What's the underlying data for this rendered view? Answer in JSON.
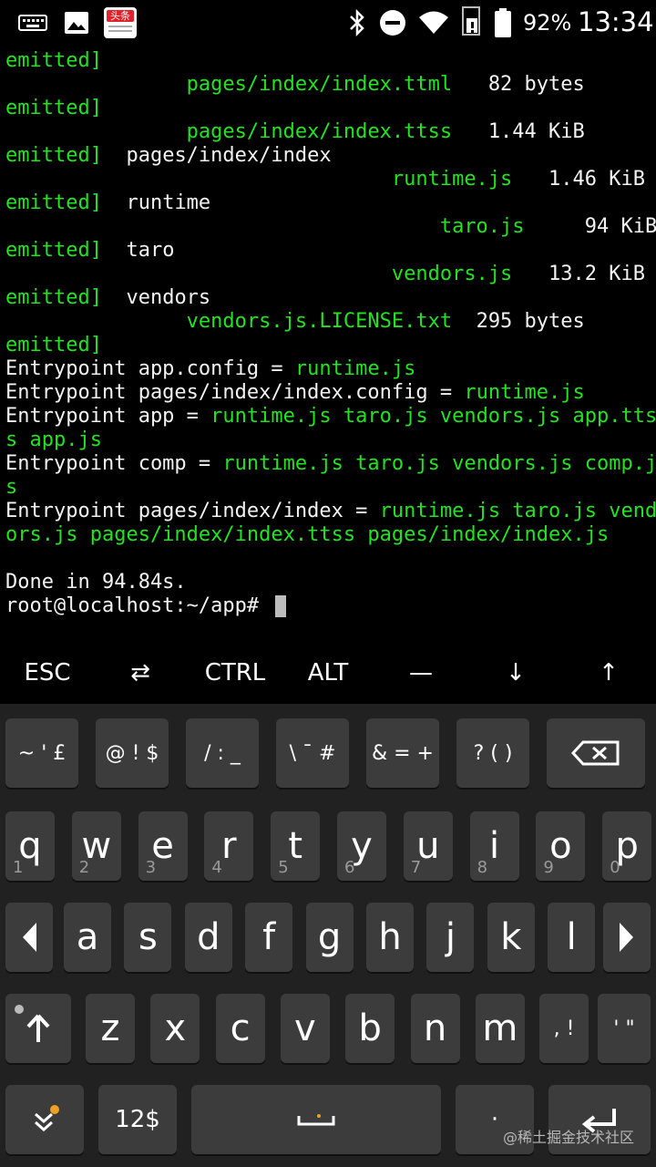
{
  "status_bar": {
    "battery_percent": "92%",
    "time": "13:34",
    "news_app_label": "头条"
  },
  "terminal": {
    "lines": [
      [
        {
          "t": "emitted]",
          "c": "g"
        }
      ],
      [
        {
          "t": "               pages/index/index.ttml",
          "c": "g"
        },
        {
          "t": "   82 bytes        ",
          "c": "w"
        },
        {
          "t": "[",
          "c": "g"
        }
      ],
      [
        {
          "t": "emitted]",
          "c": "g"
        }
      ],
      [
        {
          "t": "               pages/index/index.ttss",
          "c": "g"
        },
        {
          "t": "   1.44 KiB       6  ",
          "c": "w"
        },
        {
          "t": "[",
          "c": "g"
        }
      ],
      [
        {
          "t": "emitted]",
          "c": "g"
        },
        {
          "t": "  pages/index/index",
          "c": "w"
        }
      ],
      [
        {
          "t": "                                runtime.js",
          "c": "g"
        },
        {
          "t": "   1.46 KiB       0  ",
          "c": "w"
        },
        {
          "t": "[",
          "c": "g"
        }
      ],
      [
        {
          "t": "emitted]",
          "c": "g"
        },
        {
          "t": "  runtime",
          "c": "w"
        }
      ],
      [
        {
          "t": "                                    taro.js",
          "c": "g"
        },
        {
          "t": "     94 KiB       1  ",
          "c": "w"
        },
        {
          "t": "[",
          "c": "g"
        }
      ],
      [
        {
          "t": "emitted]",
          "c": "g"
        },
        {
          "t": "  taro",
          "c": "w"
        }
      ],
      [
        {
          "t": "                                vendors.js",
          "c": "g"
        },
        {
          "t": "   13.2 KiB       2  ",
          "c": "w"
        },
        {
          "t": "[",
          "c": "g"
        }
      ],
      [
        {
          "t": "emitted]",
          "c": "g"
        },
        {
          "t": "  vendors",
          "c": "w"
        }
      ],
      [
        {
          "t": "               vendors.js.LICENSE.txt",
          "c": "g"
        },
        {
          "t": "  295 bytes        ",
          "c": "w"
        },
        {
          "t": "[",
          "c": "g"
        }
      ],
      [
        {
          "t": "emitted]",
          "c": "g"
        }
      ],
      [
        {
          "t": "Entrypoint app.config = ",
          "c": "w"
        },
        {
          "t": "runtime.js",
          "c": "g"
        }
      ],
      [
        {
          "t": "Entrypoint pages/index/index.config = ",
          "c": "w"
        },
        {
          "t": "runtime.js",
          "c": "g"
        }
      ],
      [
        {
          "t": "Entrypoint app = ",
          "c": "w"
        },
        {
          "t": "runtime.js taro.js vendors.js app.tts",
          "c": "g"
        }
      ],
      [
        {
          "t": "s app.js",
          "c": "g"
        }
      ],
      [
        {
          "t": "Entrypoint comp = ",
          "c": "w"
        },
        {
          "t": "runtime.js taro.js vendors.js comp.j",
          "c": "g"
        }
      ],
      [
        {
          "t": "s",
          "c": "g"
        }
      ],
      [
        {
          "t": "Entrypoint pages/index/index = ",
          "c": "w"
        },
        {
          "t": "runtime.js taro.js vend",
          "c": "g"
        }
      ],
      [
        {
          "t": "ors.js pages/index/index.ttss pages/index/index.js",
          "c": "g"
        }
      ],
      [
        {
          "t": "",
          "c": "w"
        }
      ],
      [
        {
          "t": "Done in 94.84s.",
          "c": "w"
        }
      ],
      [
        {
          "t": "root@localhost:~/app# ",
          "c": "w"
        }
      ]
    ]
  },
  "extra_keys": [
    "ESC",
    "⇄",
    "CTRL",
    "ALT",
    "—",
    "↓",
    "↑"
  ],
  "keyboard": {
    "symbol_row": [
      {
        "main": "~ ' £",
        "name": "tilde-pound"
      },
      {
        "main": "@ ! $",
        "name": "at-dollar"
      },
      {
        "main": "/ : _",
        "name": "slash-underscore"
      },
      {
        "main": "\\ ¯ #",
        "name": "backslash-hash"
      },
      {
        "main": "& = +",
        "name": "ampersand-plus"
      },
      {
        "main": "? ( )",
        "name": "question-paren"
      }
    ],
    "row1": [
      {
        "k": "q",
        "h": "1"
      },
      {
        "k": "w",
        "h": "2"
      },
      {
        "k": "e",
        "h": "3"
      },
      {
        "k": "r",
        "h": "4"
      },
      {
        "k": "t",
        "h": "5"
      },
      {
        "k": "y",
        "h": "6"
      },
      {
        "k": "u",
        "h": "7"
      },
      {
        "k": "i",
        "h": "8"
      },
      {
        "k": "o",
        "h": "9"
      },
      {
        "k": "p",
        "h": "0"
      }
    ],
    "row2": [
      "a",
      "s",
      "d",
      "f",
      "g",
      "h",
      "j",
      "k",
      "l"
    ],
    "row3": [
      "z",
      "x",
      "c",
      "v",
      "b",
      "n",
      "m"
    ],
    "comma_label": ", !",
    "quote_label": "' \"",
    "numbers_label": "12$",
    "space_label": "␣",
    "watermark": "@稀土掘金技术社区"
  },
  "colors": {
    "terminal_green": "#22e31f",
    "terminal_white": "#f2f2f2",
    "key_bg": "#3c3c3c",
    "keyboard_bg": "#212121"
  }
}
